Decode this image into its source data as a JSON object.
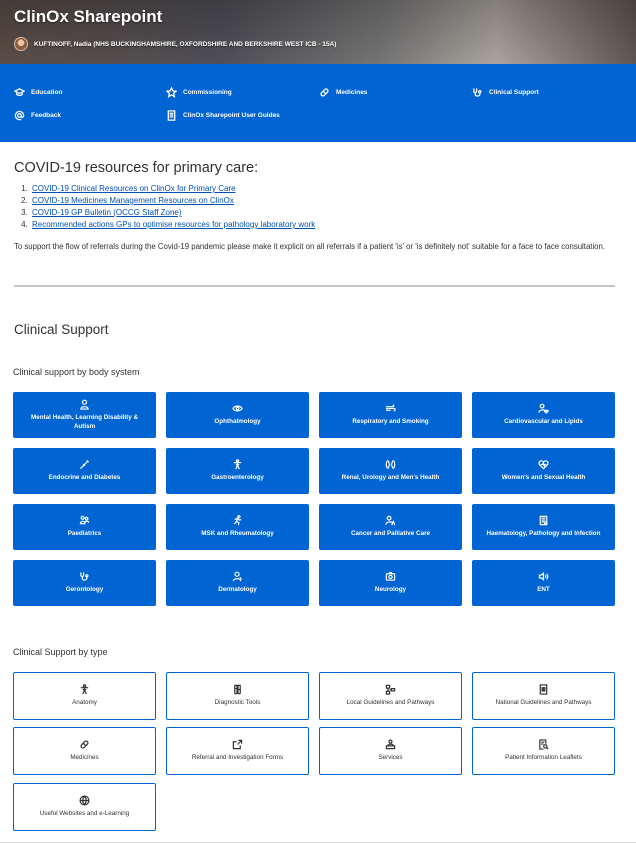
{
  "header": {
    "site_title": "ClinOx Sharepoint",
    "user": "KUFTINOFF, Nadia (NHS BUCKINGHAMSHIRE, OXFORDSHIRE AND BERKSHIRE WEST ICB - 15A)"
  },
  "nav": {
    "items": [
      {
        "label": "Education",
        "icon": "graduation-cap-icon"
      },
      {
        "label": "Commissioning",
        "icon": "star-icon"
      },
      {
        "label": "Medicines",
        "icon": "pill-icon"
      },
      {
        "label": "Clinical Support",
        "icon": "stethoscope-icon"
      },
      {
        "label": "Feedback",
        "icon": "at-sign-icon"
      },
      {
        "label": "ClinOx Sharepoint User Guides",
        "icon": "document-icon"
      }
    ]
  },
  "covid": {
    "title": "COVID-19 resources for primary care:",
    "links": [
      "COVID-19 Clinical Resources on ClinOx for Primary Care",
      "COVID-19 Medicines Management Resources on ClinOx",
      "COVID-19 GP Bulletin (OCCG Staff Zone)",
      "Recommended actions GPs to optimise resources for pathology laboratory work"
    ],
    "note": "To support the flow of referrals during the Covid-19 pandemic please make it explicit on all referrals if a patient 'is' or 'is definitely not' suitable for a face to face consultation."
  },
  "clinical_support": {
    "title": "Clinical Support",
    "by_body_system_title": "Clinical support by body system",
    "body_systems": [
      {
        "label": "Mental Health, Learning Disability & Autism",
        "icon": "person-icon"
      },
      {
        "label": "Ophthalmology",
        "icon": "eye-icon"
      },
      {
        "label": "Respiratory and Smoking",
        "icon": "lungs-icon"
      },
      {
        "label": "Cardiovascular and Lipids",
        "icon": "person-heart-icon"
      },
      {
        "label": "Endocrine and Diabetes",
        "icon": "syringe-icon"
      },
      {
        "label": "Gastroenterology",
        "icon": "body-icon"
      },
      {
        "label": "Renal, Urology and Men's Health",
        "icon": "kidney-icon"
      },
      {
        "label": "Women's and Sexual Health",
        "icon": "heart-icon"
      },
      {
        "label": "Paediatrics",
        "icon": "children-icon"
      },
      {
        "label": "MSK and Rheumatology",
        "icon": "running-icon"
      },
      {
        "label": "Cancer and Palliative Care",
        "icon": "person-ribbon-icon"
      },
      {
        "label": "Haematology, Pathology and Infection",
        "icon": "clipboard-icon"
      },
      {
        "label": "Gerontology",
        "icon": "stethoscope-icon"
      },
      {
        "label": "Dermatology",
        "icon": "person-icon"
      },
      {
        "label": "Neurology",
        "icon": "camera-icon"
      },
      {
        "label": "ENT",
        "icon": "speaker-icon"
      }
    ],
    "by_type_title": "Clinical Support by type",
    "types": [
      {
        "label": "Anatomy",
        "icon": "body-icon"
      },
      {
        "label": "Diagnostic Tools",
        "icon": "test-tubes-icon"
      },
      {
        "label": "Local Guidelines and Pathways",
        "icon": "flowchart-icon"
      },
      {
        "label": "National Guidelines and Pathways",
        "icon": "document-icon"
      },
      {
        "label": "Medicines",
        "icon": "pill-icon"
      },
      {
        "label": "Referral and Investigation Forms",
        "icon": "share-icon"
      },
      {
        "label": "Services",
        "icon": "person-desk-icon"
      },
      {
        "label": "Patient Information Leaflets",
        "icon": "document-search-icon"
      },
      {
        "label": "Useful Websites and e-Learning",
        "icon": "globe-icon"
      }
    ]
  },
  "colors": {
    "accent": "#0064d2",
    "link": "#0050b5",
    "text": "#323130"
  }
}
